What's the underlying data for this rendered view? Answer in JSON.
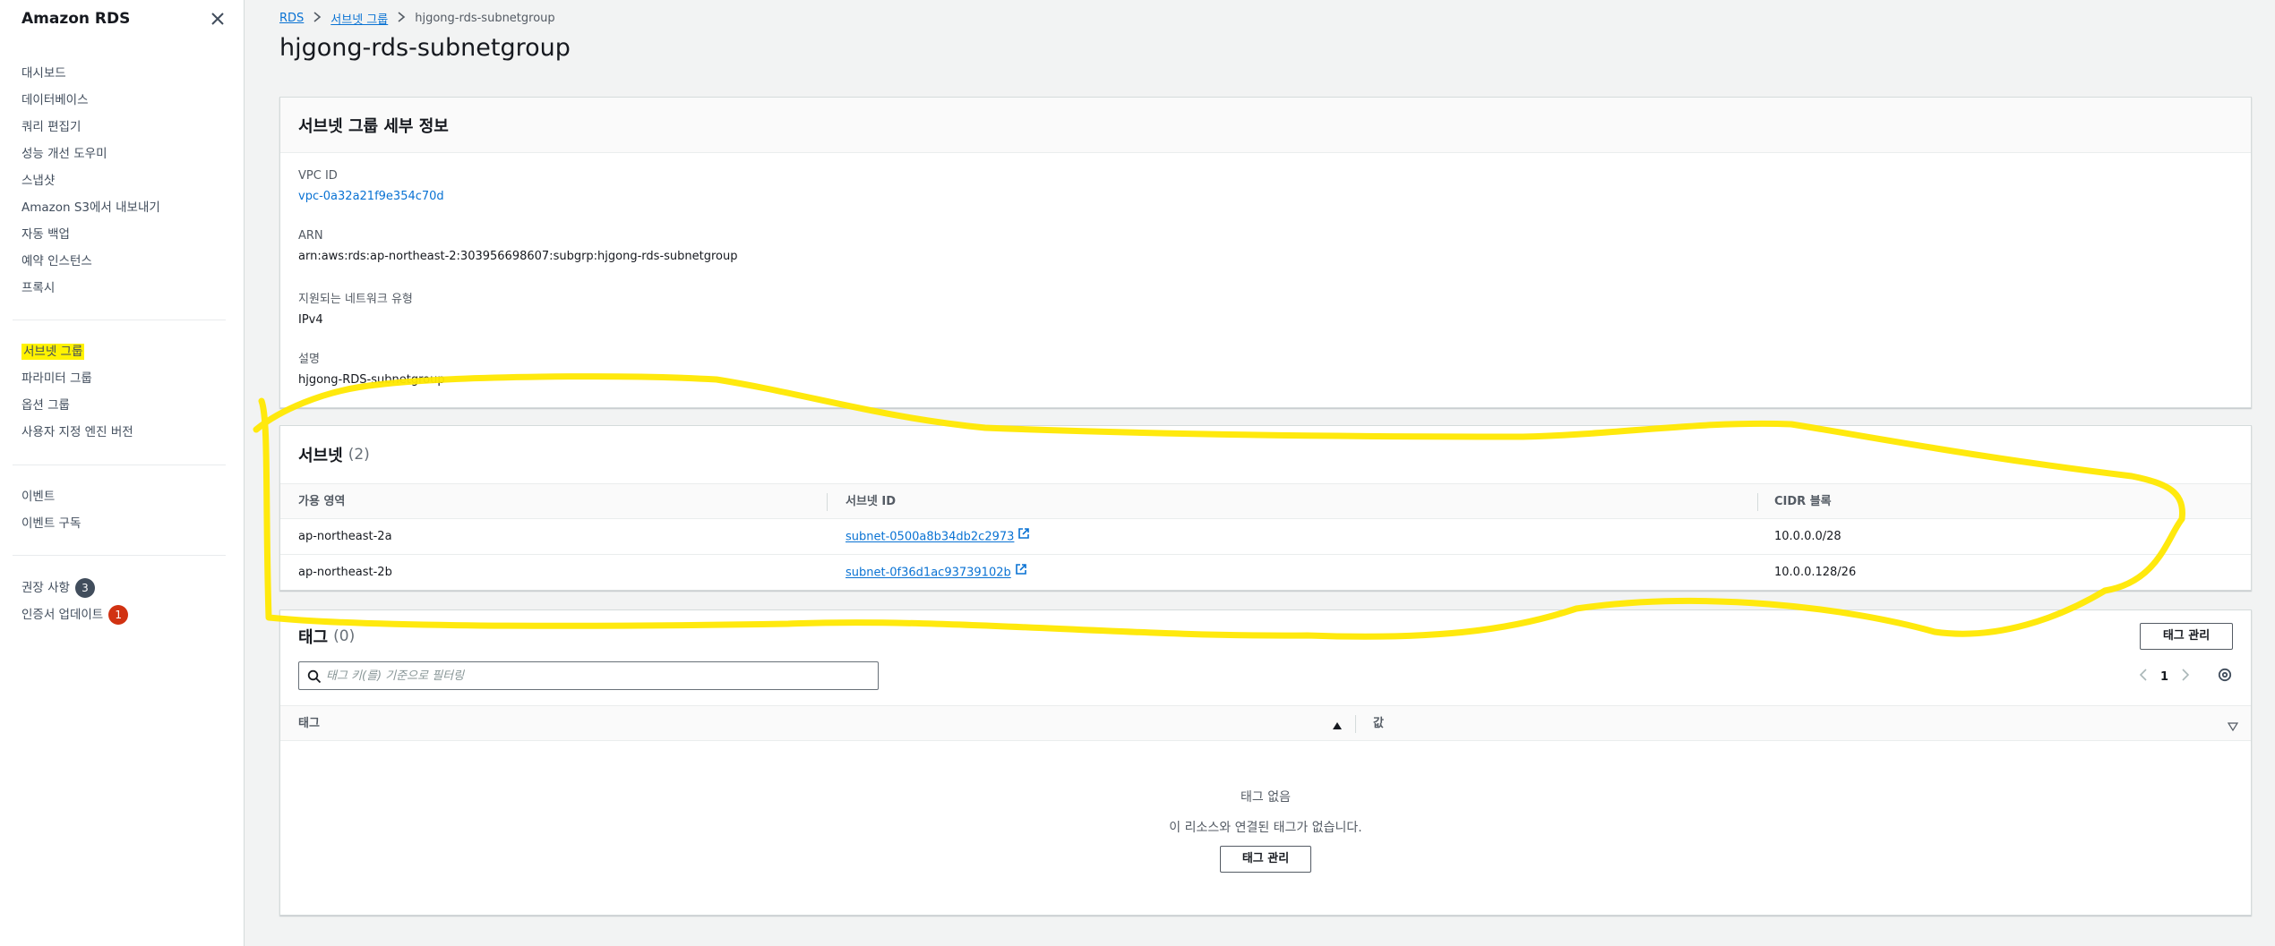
{
  "sidebar": {
    "title": "Amazon RDS",
    "close_icon": "close-icon",
    "group1": [
      "대시보드",
      "데이터베이스",
      "쿼리 편집기",
      "성능 개선 도우미",
      "스냅샷",
      "Amazon S3에서 내보내기",
      "자동 백업",
      "예약 인스턴스",
      "프록시"
    ],
    "group2": [
      "서브넷 그룹",
      "파라미터 그룹",
      "옵션 그룹",
      "사용자 지정 엔진 버전"
    ],
    "group3": [
      "이벤트",
      "이벤트 구독"
    ],
    "group4": [
      {
        "label": "권장 사항",
        "badge": "3"
      },
      {
        "label": "인증서 업데이트",
        "badge": "1"
      }
    ]
  },
  "breadcrumb": {
    "items": [
      "RDS",
      "서브넷 그룹",
      "hjgong-rds-subnetgroup"
    ]
  },
  "page_title": "hjgong-rds-subnetgroup",
  "details": {
    "title": "서브넷 그룹 세부 정보",
    "vpc_label": "VPC ID",
    "vpc_value": "vpc-0a32a21f9e354c70d",
    "arn_label": "ARN",
    "arn_value": "arn:aws:rds:ap-northeast-2:303956698607:subgrp:hjgong-rds-subnetgroup",
    "network_label": "지원되는 네트워크 유형",
    "network_value": "IPv4",
    "desc_label": "설명",
    "desc_value": "hjgong-RDS-subnetgroup"
  },
  "subnets": {
    "title": "서브넷",
    "count": "(2)",
    "columns": [
      "가용 영역",
      "서브넷 ID",
      "CIDR 블록"
    ],
    "rows": [
      {
        "az": "ap-northeast-2a",
        "id": "subnet-0500a8b34db2c2973",
        "cidr": "10.0.0.0/28"
      },
      {
        "az": "ap-northeast-2b",
        "id": "subnet-0f36d1ac93739102b",
        "cidr": "10.0.0.128/26"
      }
    ]
  },
  "tags": {
    "title": "태그",
    "count": "(0)",
    "manage_label": "태그 관리",
    "search_placeholder": "태그 키(를) 기준으로 필터링",
    "page": "1",
    "columns": [
      "태그",
      "값"
    ],
    "empty_title": "태그 없음",
    "empty_desc": "이 리소스와 연결된 태그가 없습니다.",
    "empty_button": "태그 관리"
  },
  "colors": {
    "link": "#0972d3",
    "highlight": "#fff200",
    "badge_gray": "#414d5c",
    "badge_red": "#d13212"
  }
}
